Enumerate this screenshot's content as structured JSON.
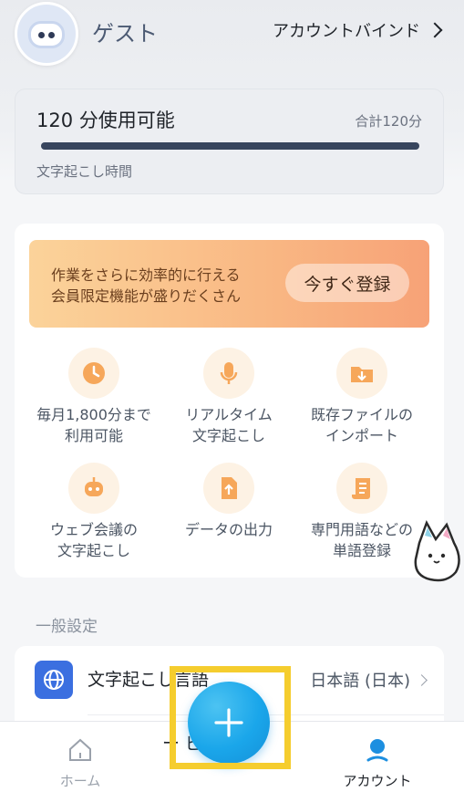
{
  "header": {
    "user_name": "ゲスト",
    "account_bind_label": "アカウントバインド"
  },
  "usage": {
    "title": "120 分使用可能",
    "total": "合計120分",
    "progress_fraction": 1.0,
    "subtitle": "文字起こし時間"
  },
  "promo": {
    "line1": "作業をさらに効率的に行える",
    "line2": "会員限定機能が盛りだくさん",
    "cta": "今すぐ登録"
  },
  "features": [
    {
      "line1": "毎月1,800分まで",
      "line2": "利用可能",
      "icon": "clock-icon"
    },
    {
      "line1": "リアルタイム",
      "line2": "文字起こし",
      "icon": "microphone-icon"
    },
    {
      "line1": "既存ファイルの",
      "line2": "インポート",
      "icon": "folder-import-icon"
    },
    {
      "line1": "ウェブ会議の",
      "line2": "文字起こし",
      "icon": "robot-icon"
    },
    {
      "line1": "データの出力",
      "line2": "",
      "icon": "file-export-icon"
    },
    {
      "line1": "専門用語などの",
      "line2": "単語登録",
      "icon": "scroll-icon"
    }
  ],
  "general": {
    "section_title": "一般設定",
    "language_label": "文字起こし言語",
    "language_value": "日本語 (日本)",
    "row2_label": "ー ビ 設定"
  },
  "nav": {
    "home": "ホーム",
    "account": "アカウント"
  },
  "colors": {
    "accent": "#1aa6ea",
    "highlight": "#f5cd2e",
    "progress": "#37455e"
  }
}
